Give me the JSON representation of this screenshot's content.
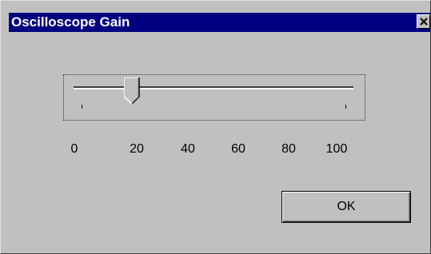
{
  "window": {
    "title": "Oscilloscope Gain",
    "title_bar_color": "#000080",
    "background_color": "#c0c0c0"
  },
  "slider": {
    "value": 10,
    "min": 0,
    "max": 100,
    "scale_labels": [
      "0",
      "20",
      "40",
      "60",
      "80",
      "100"
    ]
  },
  "buttons": {
    "ok_label": "OK"
  },
  "icons": {
    "close": "close-icon"
  }
}
